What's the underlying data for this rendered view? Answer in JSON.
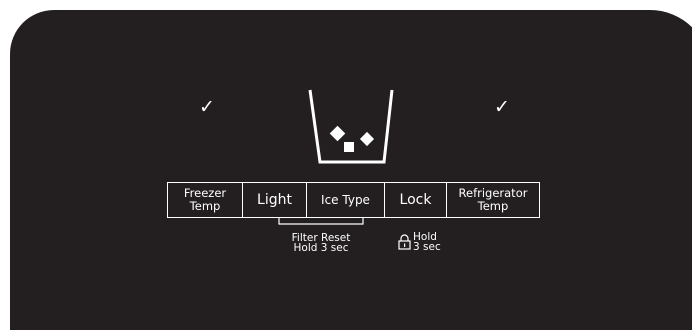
{
  "indicators": {
    "freezer_check": "✓",
    "fridge_check": "✓"
  },
  "buttons": {
    "freezer_temp": {
      "line1": "Freezer",
      "line2": "Temp"
    },
    "light": "Light",
    "ice_type": "Ice Type",
    "lock": "Lock",
    "refrigerator_temp": {
      "line1": "Refrigerator",
      "line2": "Temp"
    }
  },
  "notes": {
    "filter_reset": {
      "line1": "Filter Reset",
      "line2": "Hold 3 sec"
    },
    "hold": {
      "line1": "Hold",
      "line2": "3 sec"
    }
  },
  "icons": {
    "cup": "ice-cup-icon",
    "lock": "lock-icon"
  },
  "colors": {
    "panel": "#231f20",
    "text": "#ffffff"
  }
}
